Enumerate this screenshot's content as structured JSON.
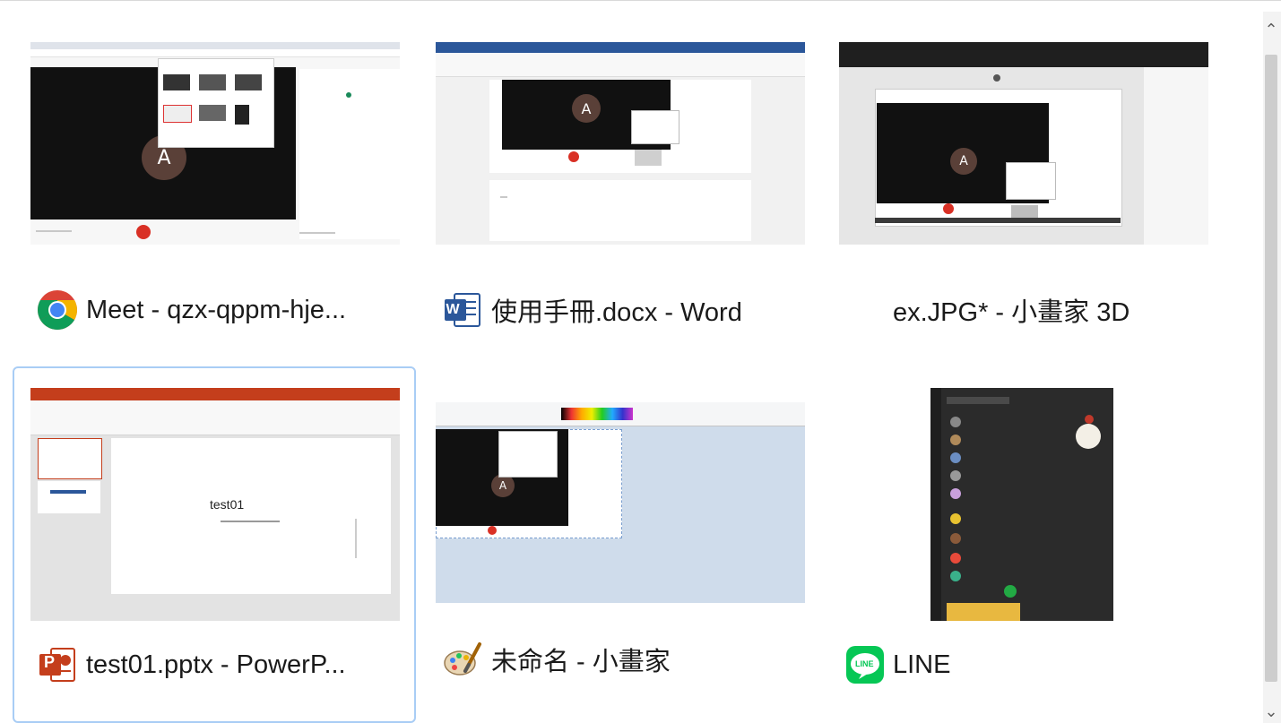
{
  "windows": [
    {
      "title": "Meet - qzx-qppm-hje...",
      "app": "chrome",
      "icon": "chrome-icon",
      "thumb_avatar": "A",
      "selected": false
    },
    {
      "title": "使用手冊.docx - Word",
      "app": "word",
      "icon": "word-icon",
      "icon_letter": "W",
      "thumb_avatar": "A",
      "selected": false
    },
    {
      "title": "ex.JPG* - 小畫家 3D",
      "app": "paint3d",
      "icon": "paint3d-icon",
      "thumb_avatar": "A",
      "selected": false
    },
    {
      "title": "test01.pptx - PowerP...",
      "app": "powerpoint",
      "icon": "powerpoint-icon",
      "icon_letter": "P",
      "thumb_text": "test01",
      "selected": true
    },
    {
      "title": "未命名 - 小畫家",
      "app": "paint",
      "icon": "paint-icon",
      "thumb_avatar": "A",
      "selected": false
    },
    {
      "title": "LINE",
      "app": "line",
      "icon": "line-icon",
      "icon_text": "LINE",
      "selected": false
    }
  ],
  "scrollbar": {
    "up_arrow": "⌃",
    "down_arrow": "⌄"
  },
  "colors": {
    "selection_border": "#a9cdf5",
    "video_black": "#111111",
    "avatar_brown": "#5a4038",
    "record_red": "#d93025",
    "word_blue": "#2b579a",
    "ppt_orange": "#c43e1c",
    "line_green": "#06c755"
  }
}
